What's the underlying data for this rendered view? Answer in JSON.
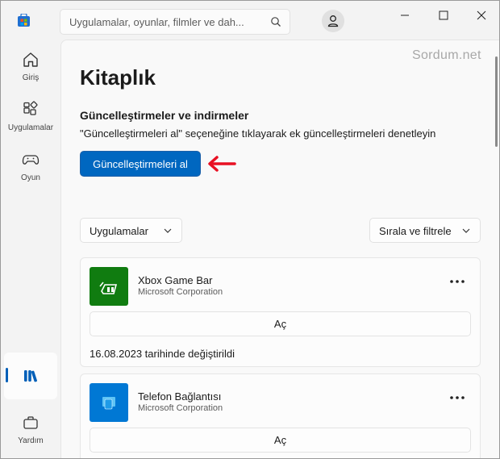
{
  "title_bar": {
    "search_placeholder": "Uygulamalar, oyunlar, filmler ve dah..."
  },
  "nav": {
    "items": [
      {
        "label": "Giriş",
        "icon": "home-icon"
      },
      {
        "label": "Uygulamalar",
        "icon": "apps-icon"
      },
      {
        "label": "Oyun",
        "icon": "gamepad-icon"
      },
      {
        "label": "",
        "icon": "library-icon",
        "active": true
      },
      {
        "label": "Yardım",
        "icon": "help-briefcase-icon"
      }
    ]
  },
  "watermark": "Sordum.net",
  "page_title": "Kitaplık",
  "updates": {
    "title": "Güncelleştirmeler ve indirmeler",
    "description": "\"Güncelleştirmeleri al\" seçeneğine tıklayarak ek güncelleştirmeleri denetleyin",
    "button": "Güncelleştirmeleri al"
  },
  "filters": {
    "category": "Uygulamalar",
    "sort": "Sırala ve filtrele"
  },
  "apps": [
    {
      "name": "Xbox Game Bar",
      "publisher": "Microsoft Corporation",
      "action": "Aç",
      "modified": "16.08.2023 tarihinde değiştirildi",
      "tile_color": "#107c10"
    },
    {
      "name": "Telefon Bağlantısı",
      "publisher": "Microsoft Corporation",
      "action": "Aç",
      "tile_color": "#0078d4"
    }
  ],
  "colors": {
    "accent": "#0067c0",
    "arrow": "#e81123"
  }
}
